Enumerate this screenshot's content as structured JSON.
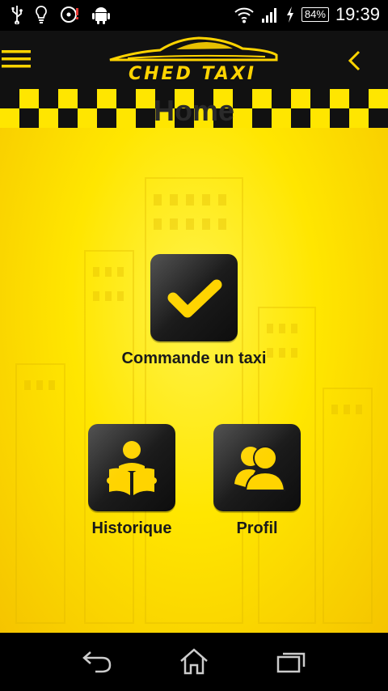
{
  "status_bar": {
    "battery_percent": "84%",
    "time": "19:39"
  },
  "app_bar": {
    "logo_text": "CHED TAXI"
  },
  "page": {
    "title": "Home"
  },
  "tiles": [
    {
      "label": "Commande un taxi",
      "icon": "checkmark-icon"
    },
    {
      "label": "Historique",
      "icon": "reading-person-icon"
    },
    {
      "label": "Profil",
      "icon": "users-icon"
    }
  ],
  "colors": {
    "accent_yellow": "#ffe600",
    "tile_dark": "#1a1a1a",
    "bar_black": "#000000"
  }
}
